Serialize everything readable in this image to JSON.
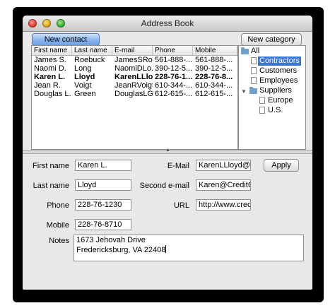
{
  "window": {
    "title": "Address Book"
  },
  "toolbar": {
    "new_contact": "New contact",
    "new_category": "New category"
  },
  "table": {
    "columns": [
      "First name",
      "Last name",
      "E-mail",
      "Phone",
      "Mobile"
    ],
    "rows": [
      [
        "James S.",
        "Roebuck",
        "JamesSRoe...",
        "561-888-...",
        "561-888-..."
      ],
      [
        "Naomi D.",
        "Long",
        "NaomiDLo...",
        "390-12-5...",
        "390-12-5..."
      ],
      [
        "Karen L.",
        "Lloyd",
        "KarenLLlo...",
        "228-76-1...",
        "228-76-8..."
      ],
      [
        "Jean R.",
        "Voigt",
        "JeanRVoigt...",
        "610-344-...",
        "610-344-..."
      ],
      [
        "Douglas L.",
        "Green",
        "DouglasLG...",
        "612-615-...",
        "612-615-..."
      ]
    ],
    "selected_row": 2
  },
  "tree": {
    "root": "All",
    "items": [
      {
        "label": "Contractors",
        "selected": true
      },
      {
        "label": "Customers"
      },
      {
        "label": "Employees"
      }
    ],
    "group": "Suppliers",
    "group_items": [
      {
        "label": "Europe"
      },
      {
        "label": "U.S."
      }
    ]
  },
  "form": {
    "first_name_label": "First name",
    "first_name": "Karen L.",
    "last_name_label": "Last name",
    "last_name": "Lloyd",
    "phone_label": "Phone",
    "phone": "228-76-1230",
    "mobile_label": "Mobile",
    "mobile": "228-76-8710",
    "email_label": "E-Mail",
    "email": "KarenLLloyd@ex",
    "second_email_label": "Second e-mail",
    "second_email": "Karen@CreditCa",
    "url_label": "URL",
    "url": "http://www.cred",
    "notes_label": "Notes",
    "notes_line1": "1673 Jehovah Drive",
    "notes_line2": "Fredericksburg, VA 22408",
    "apply": "Apply"
  }
}
